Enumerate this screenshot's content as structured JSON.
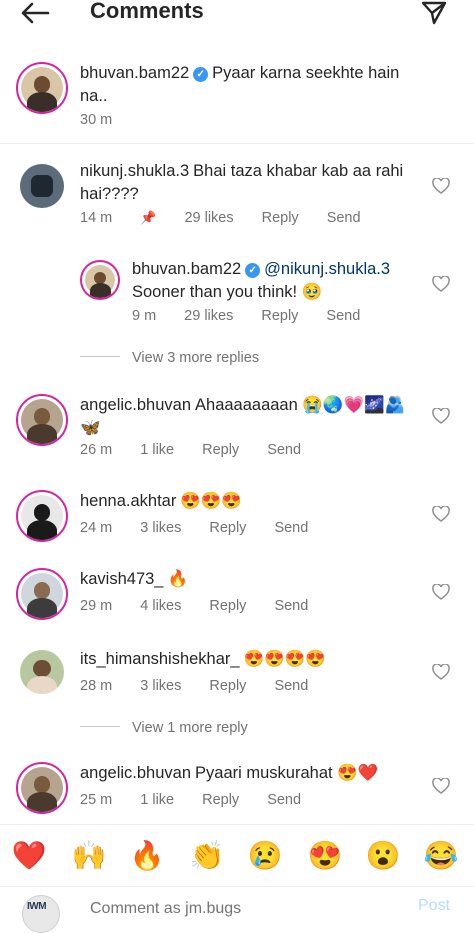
{
  "header": {
    "title": "Comments"
  },
  "caption": {
    "username": "bhuvan.bam22",
    "verified": true,
    "text": "Pyaar karna seekhte hain na..",
    "time": "30 m"
  },
  "comments": [
    {
      "username": "nikunj.shukla.3",
      "text": "Bhai taza khabar kab aa rahi hai????",
      "time": "14 m",
      "pinned": true,
      "likes": "29 likes",
      "reply": "Reply",
      "send": "Send"
    },
    {
      "username": "bhuvan.bam22",
      "verified": true,
      "mention": "@nikunj.shukla.3",
      "text": "Sooner than you think! 🥹",
      "time": "9 m",
      "likes": "29 likes",
      "reply": "Reply",
      "send": "Send"
    },
    {
      "username": "angelic.bhuvan",
      "text": "Ahaaaaaaaan 😭🌏💗🌌🫂🦋",
      "time": "26 m",
      "likes": "1 like",
      "reply": "Reply",
      "send": "Send"
    },
    {
      "username": "henna.akhtar",
      "text": "😍😍😍",
      "time": "24 m",
      "likes": "3 likes",
      "reply": "Reply",
      "send": "Send"
    },
    {
      "username": "kavish473_",
      "text": "🔥",
      "time": "29 m",
      "likes": "4 likes",
      "reply": "Reply",
      "send": "Send"
    },
    {
      "username": "its_himanshishekhar_",
      "text": "😍😍😍😍",
      "time": "28 m",
      "likes": "3 likes",
      "reply": "Reply",
      "send": "Send"
    },
    {
      "username": "angelic.bhuvan",
      "text": "Pyaari muskurahat 😍❤️",
      "time": "25 m",
      "likes": "1 like",
      "reply": "Reply",
      "send": "Send"
    }
  ],
  "view_more_1": "View 3 more replies",
  "view_more_2": "View 1 more reply",
  "emoji_bar": [
    "❤️",
    "🙌",
    "🔥",
    "👏",
    "😢",
    "😍",
    "😮",
    "😂"
  ],
  "input": {
    "placeholder": "Comment as jm.bugs",
    "post": "Post",
    "avatar_text": "IWM"
  },
  "colors": {
    "accent": "#3897f0",
    "ring": "#d6249f",
    "muted": "#737373"
  }
}
